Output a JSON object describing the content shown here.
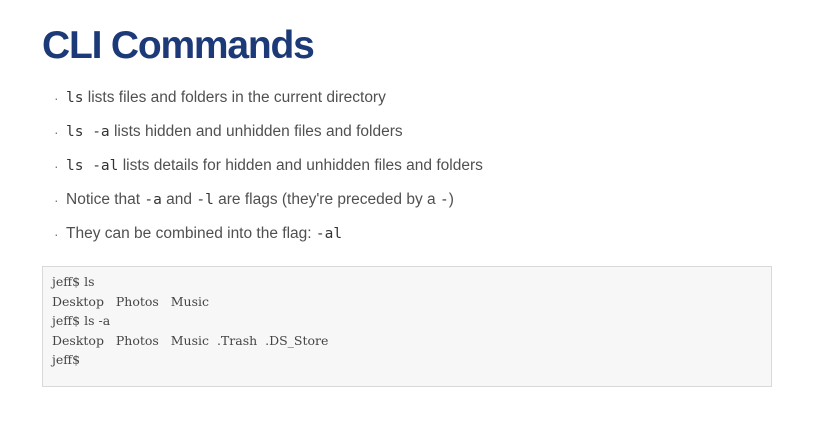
{
  "title": "CLI Commands",
  "bullets": [
    {
      "code": "ls",
      "text": " lists files and folders in the current directory"
    },
    {
      "code": "ls -a",
      "text": " lists hidden and unhidden files and folders"
    },
    {
      "code": "ls -al",
      "text": " lists details for hidden and unhidden files and folders"
    },
    {
      "pre": "Notice that ",
      "code1": "-a",
      "mid": " and ",
      "code2": "-l",
      "post": " are flags (they're preceded by a ",
      "code3": "-",
      "end": ")"
    },
    {
      "pre": "They can be combined into the flag: ",
      "code": "-al"
    }
  ],
  "bullet_glyph": "·",
  "terminal": {
    "lines": [
      "jeff$ ls",
      "Desktop   Photos   Music",
      "jeff$ ls -a",
      "Desktop   Photos   Music  .Trash  .DS_Store",
      "jeff$"
    ]
  }
}
